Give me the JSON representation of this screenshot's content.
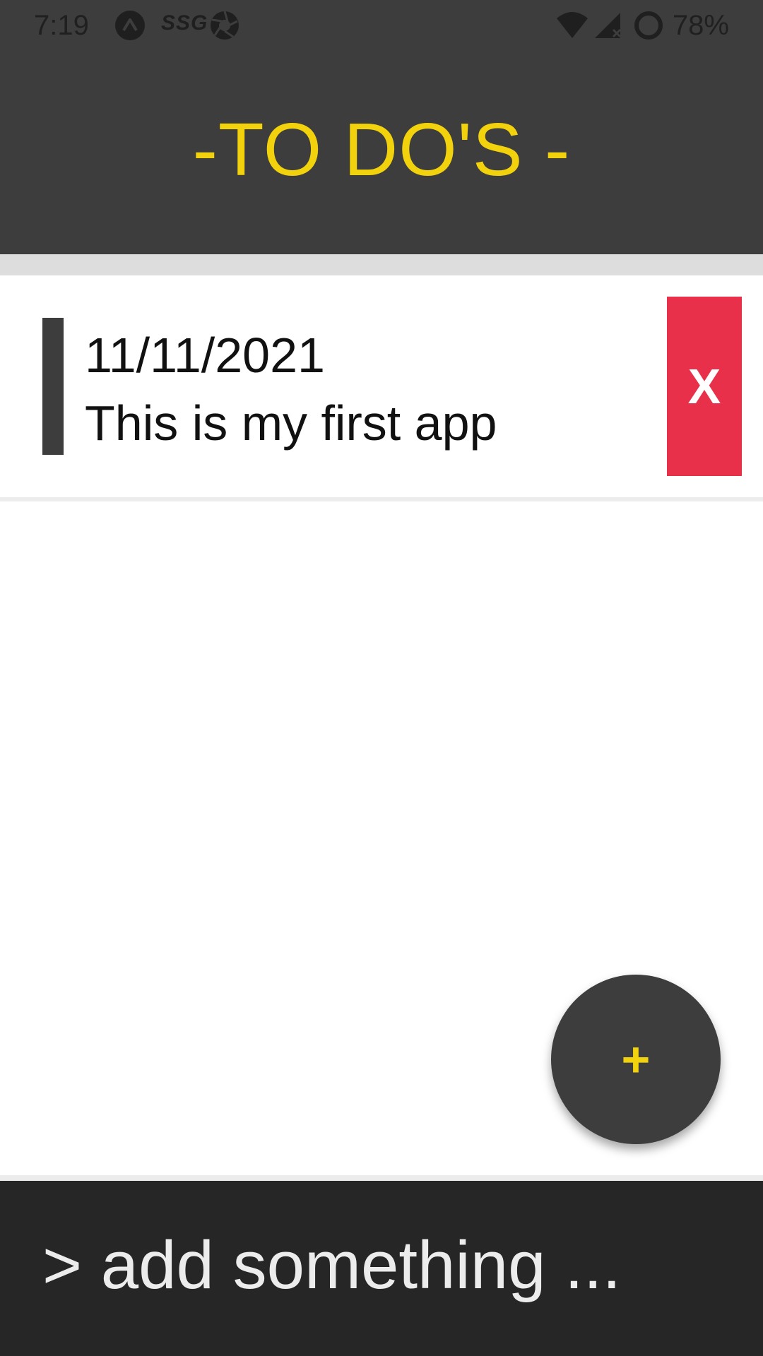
{
  "status_bar": {
    "time": "7:19",
    "notification_icons": [
      "app-icon",
      "ssg-icon",
      "aperture-icon"
    ],
    "ssg_label": "SSG",
    "system_icons": [
      "wifi-icon",
      "signal-icon",
      "battery-icon"
    ],
    "battery_percent": "78%"
  },
  "header": {
    "title": "-TO DO'S -",
    "title_color": "#f2d20d",
    "background": "#3d3d3d"
  },
  "todos": [
    {
      "date": "11/11/2021",
      "text": "This is my first app",
      "delete_label": "X"
    }
  ],
  "fab": {
    "label": "+",
    "icon": "plus-icon"
  },
  "add_input": {
    "value": "",
    "placeholder": "> add something ..."
  },
  "colors": {
    "accent_yellow": "#f2d20d",
    "dark": "#3d3d3d",
    "delete_red": "#e9304a",
    "input_bar": "#262626"
  }
}
